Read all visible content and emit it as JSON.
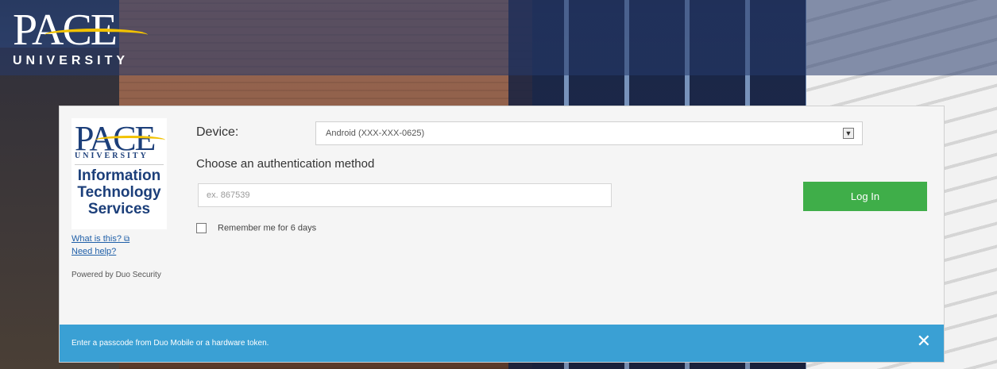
{
  "header": {
    "logo_word": "PACE",
    "logo_subtitle": "UNIVERSITY"
  },
  "sidebar": {
    "logo_word": "PACE",
    "logo_subtitle": "UNIVERSITY",
    "dept_name": "Information Technology Services",
    "what_is_this": "What is this?",
    "need_help": "Need help?",
    "powered_by": "Powered by Duo Security"
  },
  "form": {
    "device_label": "Device:",
    "device_value": "Android (XXX-XXX-0625)",
    "method_label": "Choose an authentication method",
    "passcode_placeholder": "ex. 867539",
    "login_label": "Log In",
    "remember_label": "Remember me for 6 days"
  },
  "message": {
    "text": "Enter a passcode from Duo Mobile or a hardware token.",
    "close_glyph": "✕"
  },
  "colors": {
    "accent_green": "#3fae49",
    "message_blue": "#3aa0d4",
    "pace_blue": "#1c3f7a",
    "pace_gold": "#f2c200"
  },
  "icons": {
    "external_link": "external-link-icon",
    "dropdown": "chevron-down-icon",
    "close": "close-icon"
  }
}
